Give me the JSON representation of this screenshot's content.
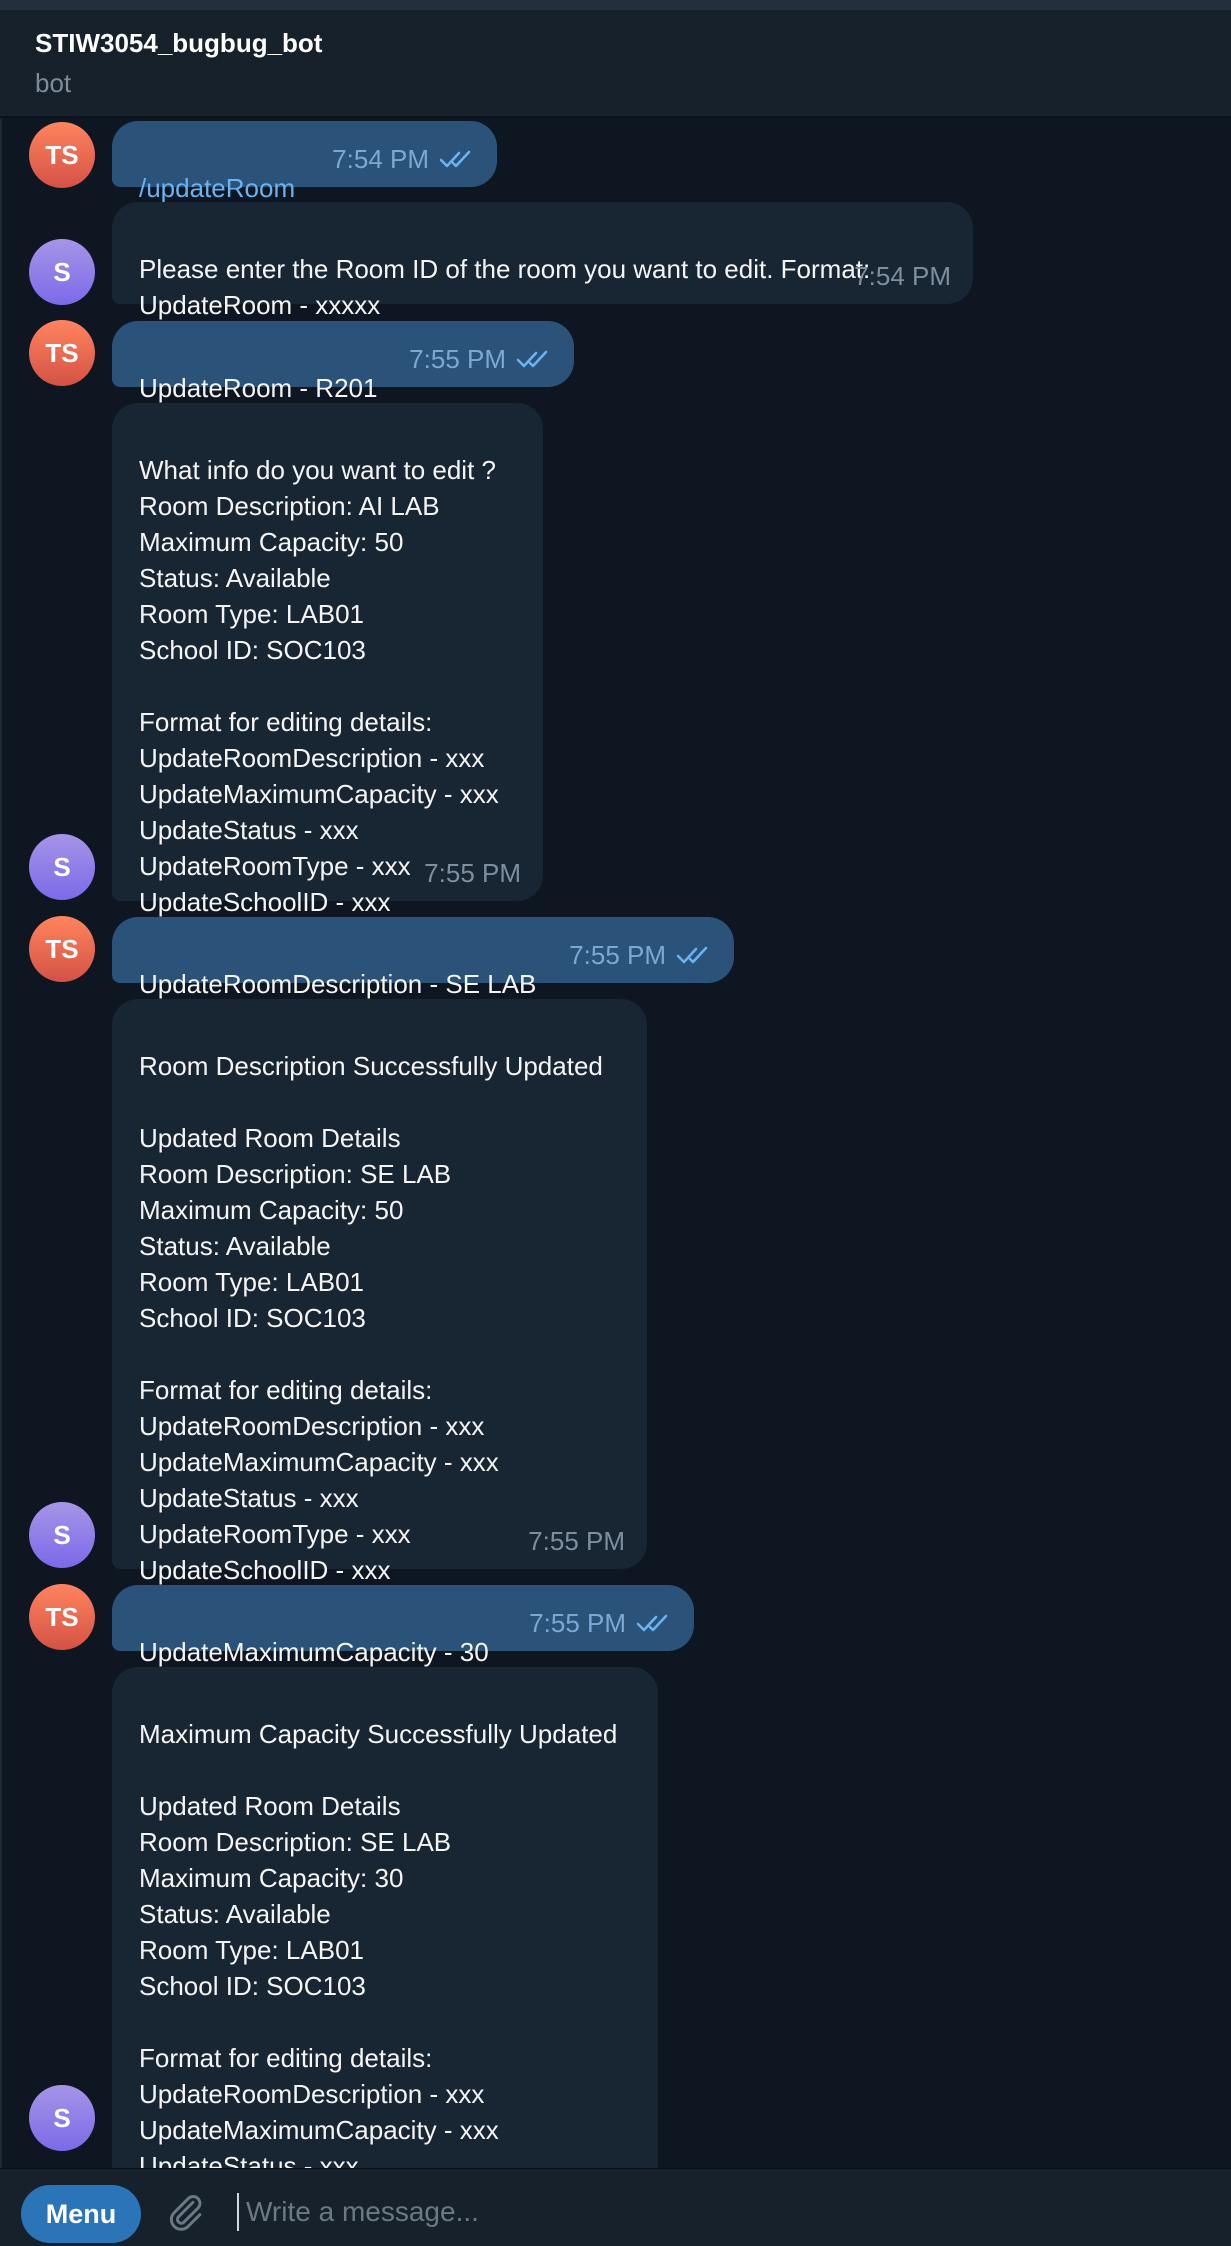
{
  "header": {
    "title": "STIW3054_bugbug_bot",
    "subtitle": "bot"
  },
  "avatars": {
    "user": "TS",
    "bot": "S"
  },
  "messages": [
    {
      "from": "user",
      "text": "/updateRoom",
      "time": "7:54 PM",
      "status": "read"
    },
    {
      "from": "bot",
      "text": "Please enter the Room ID of the room you want to edit. Format:\nUpdateRoom - xxxxx",
      "time": "7:54 PM"
    },
    {
      "from": "user",
      "text": "UpdateRoom - R201",
      "time": "7:55 PM",
      "status": "read"
    },
    {
      "from": "bot",
      "text": "What info do you want to edit ?\nRoom Description: AI LAB\nMaximum Capacity: 50\nStatus: Available\nRoom Type: LAB01\nSchool ID: SOC103\n\nFormat for editing details:\nUpdateRoomDescription - xxx\nUpdateMaximumCapacity - xxx\nUpdateStatus - xxx\nUpdateRoomType - xxx\nUpdateSchoolID - xxx",
      "time": "7:55 PM"
    },
    {
      "from": "user",
      "text": "UpdateRoomDescription - SE LAB",
      "time": "7:55 PM",
      "status": "read"
    },
    {
      "from": "bot",
      "text": "Room Description Successfully Updated\n\nUpdated Room Details\nRoom Description: SE LAB\nMaximum Capacity: 50\nStatus: Available\nRoom Type: LAB01\nSchool ID: SOC103\n\nFormat for editing details:\nUpdateRoomDescription - xxx\nUpdateMaximumCapacity - xxx\nUpdateStatus - xxx\nUpdateRoomType - xxx\nUpdateSchoolID - xxx",
      "time": "7:55 PM"
    },
    {
      "from": "user",
      "text": "UpdateMaximumCapacity - 30",
      "time": "7:55 PM",
      "status": "read"
    },
    {
      "from": "bot",
      "text": "Maximum Capacity Successfully Updated\n\nUpdated Room Details\nRoom Description: SE LAB\nMaximum Capacity: 30\nStatus: Available\nRoom Type: LAB01\nSchool ID: SOC103\n\nFormat for editing details:\nUpdateRoomDescription - xxx\nUpdateMaximumCapacity - xxx\nUpdateStatus - xxx\nUpdateRoomType - xxx",
      "time": ""
    }
  ],
  "composer": {
    "menu_label": "Menu",
    "placeholder": "Write a message...",
    "attach_icon": "paperclip-icon"
  },
  "colors": {
    "background": "#0e1621",
    "header": "#17212b",
    "outgoing": "#2b5278",
    "incoming": "#182533",
    "accent": "#6ab3f3",
    "menu": "#2b74b8"
  }
}
